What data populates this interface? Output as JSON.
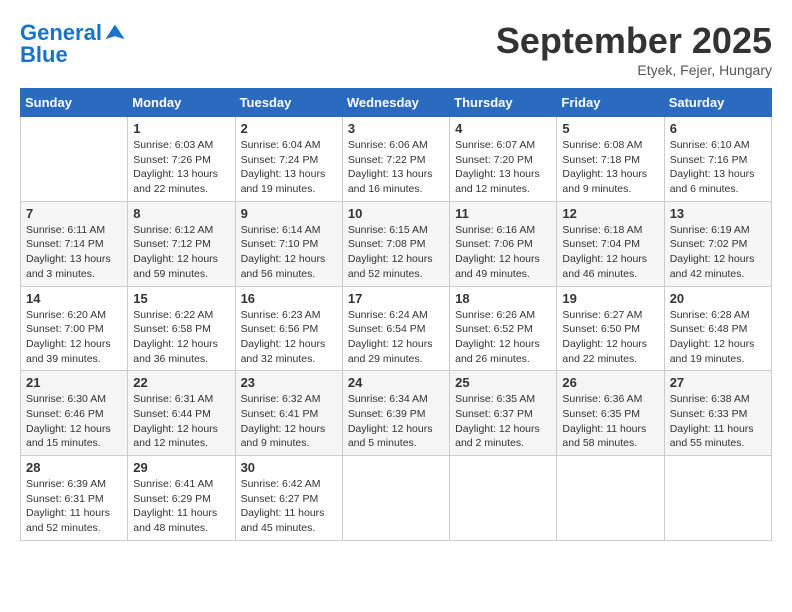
{
  "header": {
    "logo_line1": "General",
    "logo_line2": "Blue",
    "month": "September 2025",
    "location": "Etyek, Fejer, Hungary"
  },
  "days_of_week": [
    "Sunday",
    "Monday",
    "Tuesday",
    "Wednesday",
    "Thursday",
    "Friday",
    "Saturday"
  ],
  "weeks": [
    [
      {
        "day": "",
        "sunrise": "",
        "sunset": "",
        "daylight": ""
      },
      {
        "day": "1",
        "sunrise": "Sunrise: 6:03 AM",
        "sunset": "Sunset: 7:26 PM",
        "daylight": "Daylight: 13 hours and 22 minutes."
      },
      {
        "day": "2",
        "sunrise": "Sunrise: 6:04 AM",
        "sunset": "Sunset: 7:24 PM",
        "daylight": "Daylight: 13 hours and 19 minutes."
      },
      {
        "day": "3",
        "sunrise": "Sunrise: 6:06 AM",
        "sunset": "Sunset: 7:22 PM",
        "daylight": "Daylight: 13 hours and 16 minutes."
      },
      {
        "day": "4",
        "sunrise": "Sunrise: 6:07 AM",
        "sunset": "Sunset: 7:20 PM",
        "daylight": "Daylight: 13 hours and 12 minutes."
      },
      {
        "day": "5",
        "sunrise": "Sunrise: 6:08 AM",
        "sunset": "Sunset: 7:18 PM",
        "daylight": "Daylight: 13 hours and 9 minutes."
      },
      {
        "day": "6",
        "sunrise": "Sunrise: 6:10 AM",
        "sunset": "Sunset: 7:16 PM",
        "daylight": "Daylight: 13 hours and 6 minutes."
      }
    ],
    [
      {
        "day": "7",
        "sunrise": "Sunrise: 6:11 AM",
        "sunset": "Sunset: 7:14 PM",
        "daylight": "Daylight: 13 hours and 3 minutes."
      },
      {
        "day": "8",
        "sunrise": "Sunrise: 6:12 AM",
        "sunset": "Sunset: 7:12 PM",
        "daylight": "Daylight: 12 hours and 59 minutes."
      },
      {
        "day": "9",
        "sunrise": "Sunrise: 6:14 AM",
        "sunset": "Sunset: 7:10 PM",
        "daylight": "Daylight: 12 hours and 56 minutes."
      },
      {
        "day": "10",
        "sunrise": "Sunrise: 6:15 AM",
        "sunset": "Sunset: 7:08 PM",
        "daylight": "Daylight: 12 hours and 52 minutes."
      },
      {
        "day": "11",
        "sunrise": "Sunrise: 6:16 AM",
        "sunset": "Sunset: 7:06 PM",
        "daylight": "Daylight: 12 hours and 49 minutes."
      },
      {
        "day": "12",
        "sunrise": "Sunrise: 6:18 AM",
        "sunset": "Sunset: 7:04 PM",
        "daylight": "Daylight: 12 hours and 46 minutes."
      },
      {
        "day": "13",
        "sunrise": "Sunrise: 6:19 AM",
        "sunset": "Sunset: 7:02 PM",
        "daylight": "Daylight: 12 hours and 42 minutes."
      }
    ],
    [
      {
        "day": "14",
        "sunrise": "Sunrise: 6:20 AM",
        "sunset": "Sunset: 7:00 PM",
        "daylight": "Daylight: 12 hours and 39 minutes."
      },
      {
        "day": "15",
        "sunrise": "Sunrise: 6:22 AM",
        "sunset": "Sunset: 6:58 PM",
        "daylight": "Daylight: 12 hours and 36 minutes."
      },
      {
        "day": "16",
        "sunrise": "Sunrise: 6:23 AM",
        "sunset": "Sunset: 6:56 PM",
        "daylight": "Daylight: 12 hours and 32 minutes."
      },
      {
        "day": "17",
        "sunrise": "Sunrise: 6:24 AM",
        "sunset": "Sunset: 6:54 PM",
        "daylight": "Daylight: 12 hours and 29 minutes."
      },
      {
        "day": "18",
        "sunrise": "Sunrise: 6:26 AM",
        "sunset": "Sunset: 6:52 PM",
        "daylight": "Daylight: 12 hours and 26 minutes."
      },
      {
        "day": "19",
        "sunrise": "Sunrise: 6:27 AM",
        "sunset": "Sunset: 6:50 PM",
        "daylight": "Daylight: 12 hours and 22 minutes."
      },
      {
        "day": "20",
        "sunrise": "Sunrise: 6:28 AM",
        "sunset": "Sunset: 6:48 PM",
        "daylight": "Daylight: 12 hours and 19 minutes."
      }
    ],
    [
      {
        "day": "21",
        "sunrise": "Sunrise: 6:30 AM",
        "sunset": "Sunset: 6:46 PM",
        "daylight": "Daylight: 12 hours and 15 minutes."
      },
      {
        "day": "22",
        "sunrise": "Sunrise: 6:31 AM",
        "sunset": "Sunset: 6:44 PM",
        "daylight": "Daylight: 12 hours and 12 minutes."
      },
      {
        "day": "23",
        "sunrise": "Sunrise: 6:32 AM",
        "sunset": "Sunset: 6:41 PM",
        "daylight": "Daylight: 12 hours and 9 minutes."
      },
      {
        "day": "24",
        "sunrise": "Sunrise: 6:34 AM",
        "sunset": "Sunset: 6:39 PM",
        "daylight": "Daylight: 12 hours and 5 minutes."
      },
      {
        "day": "25",
        "sunrise": "Sunrise: 6:35 AM",
        "sunset": "Sunset: 6:37 PM",
        "daylight": "Daylight: 12 hours and 2 minutes."
      },
      {
        "day": "26",
        "sunrise": "Sunrise: 6:36 AM",
        "sunset": "Sunset: 6:35 PM",
        "daylight": "Daylight: 11 hours and 58 minutes."
      },
      {
        "day": "27",
        "sunrise": "Sunrise: 6:38 AM",
        "sunset": "Sunset: 6:33 PM",
        "daylight": "Daylight: 11 hours and 55 minutes."
      }
    ],
    [
      {
        "day": "28",
        "sunrise": "Sunrise: 6:39 AM",
        "sunset": "Sunset: 6:31 PM",
        "daylight": "Daylight: 11 hours and 52 minutes."
      },
      {
        "day": "29",
        "sunrise": "Sunrise: 6:41 AM",
        "sunset": "Sunset: 6:29 PM",
        "daylight": "Daylight: 11 hours and 48 minutes."
      },
      {
        "day": "30",
        "sunrise": "Sunrise: 6:42 AM",
        "sunset": "Sunset: 6:27 PM",
        "daylight": "Daylight: 11 hours and 45 minutes."
      },
      {
        "day": "",
        "sunrise": "",
        "sunset": "",
        "daylight": ""
      },
      {
        "day": "",
        "sunrise": "",
        "sunset": "",
        "daylight": ""
      },
      {
        "day": "",
        "sunrise": "",
        "sunset": "",
        "daylight": ""
      },
      {
        "day": "",
        "sunrise": "",
        "sunset": "",
        "daylight": ""
      }
    ]
  ]
}
